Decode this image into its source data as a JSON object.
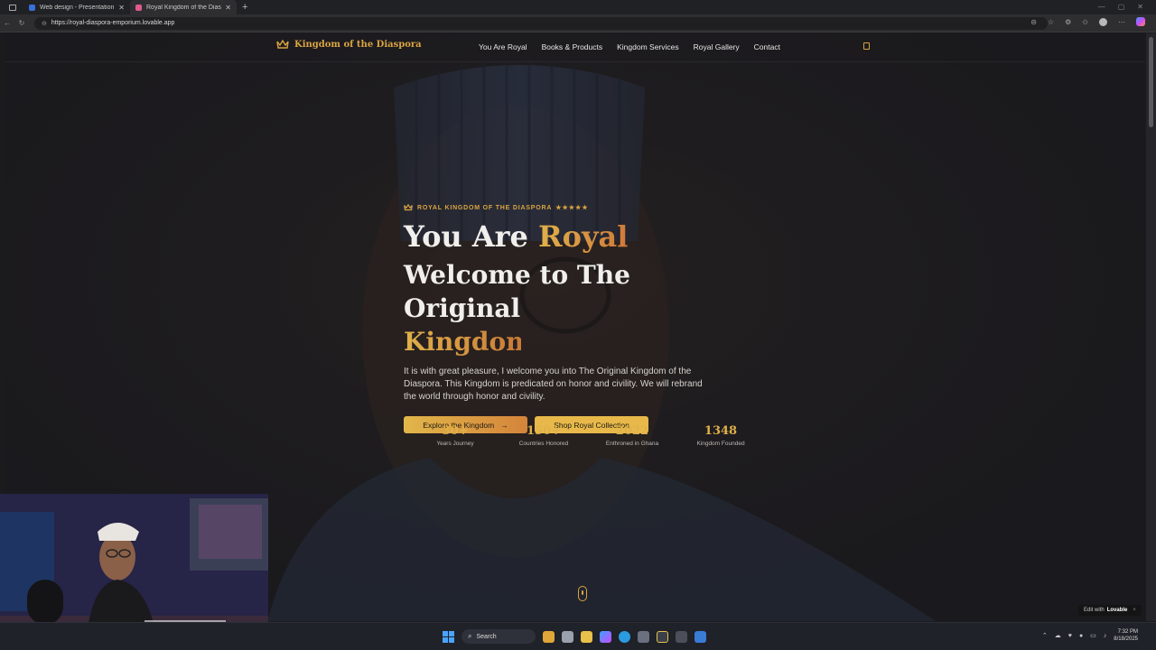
{
  "browser": {
    "tabs": [
      {
        "title": "Web design - Presentation",
        "active": false,
        "favicon_color": "#3b6fd8"
      },
      {
        "title": "Royal Kingdom of the Diaspora",
        "active": true,
        "favicon_color": "#e05a8a"
      }
    ],
    "new_tab": "+",
    "url": "https://royal-diaspora-emporium.lovable.app"
  },
  "site": {
    "brand": "Kingdom of the Diaspora",
    "nav": [
      "You Are Royal",
      "Books & Products",
      "Kingdom Services",
      "Royal Gallery",
      "Contact"
    ],
    "cart_icon": "shopping-bag-icon",
    "accent_color": "#d9a441"
  },
  "hero": {
    "eyebrow": "ROYAL KINGDOM OF THE DIASPORA",
    "stars": "★★★★★",
    "heading_part1": "You Are ",
    "heading_gold1": "Royal",
    "heading_line2": "Welcome to The Original",
    "heading_gold2": "Kingdom",
    "lead": "It is with great pleasure, I welcome you into The Original Kingdom of the Diaspora. This Kingdom is predicated on honor and civility. We will rebrand the world through honor and civility.",
    "cta_primary": "Explore the Kingdom",
    "cta_primary_arrow": "→",
    "cta_secondary": "Shop Royal Collection"
  },
  "stats": [
    {
      "value": "30+",
      "label": "Years Journey"
    },
    {
      "value": "150+",
      "label": "Countries Honored"
    },
    {
      "value": "2022",
      "label": "Enthroned in Ghana"
    },
    {
      "value": "1348",
      "label": "Kingdom Founded"
    }
  ],
  "lovable_badge": {
    "prefix": "Edit with",
    "brand": "Lovable",
    "close": "×"
  },
  "taskbar": {
    "search_placeholder": "Search",
    "time": "7:32 PM",
    "date": "8/18/2025"
  }
}
